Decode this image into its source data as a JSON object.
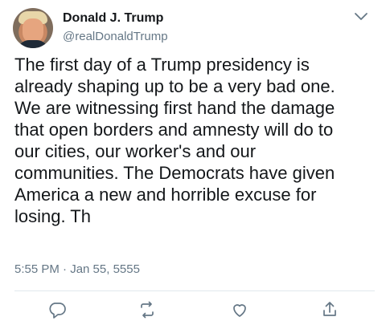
{
  "tweet": {
    "author_name": "Donald J. Trump",
    "author_handle": "@realDonaldTrump",
    "text": "The first day of a Trump presidency is\nalready shaping up to be a very bad one.\nWe are witnessing first hand the damage\nthat open borders and amnesty will do to\nour cities, our worker's and our\ncommunities. The Democrats have given\nAmerica a new and horrible excuse for\nlosing. Th",
    "timestamp": "5:55 PM · Jan 55, 5555"
  },
  "icons": {
    "menu": "chevron-down-icon",
    "reply": "reply-icon",
    "retweet": "retweet-icon",
    "like": "heart-icon",
    "share": "share-icon"
  },
  "colors": {
    "text": "#14171a",
    "secondary": "#657786",
    "divider": "#e1e8ed",
    "icon": "#657786"
  }
}
